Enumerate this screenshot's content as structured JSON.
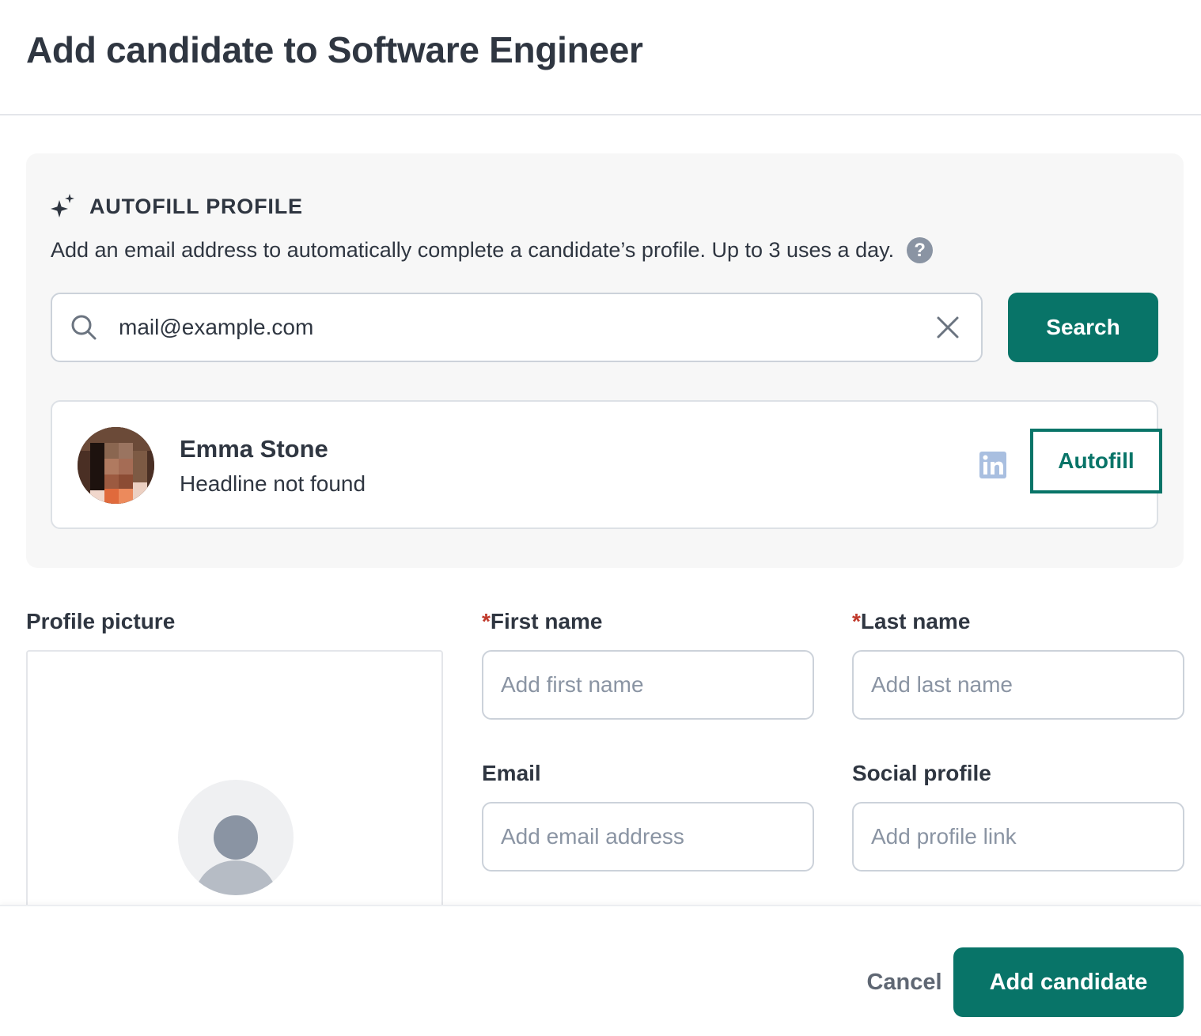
{
  "modal": {
    "title": "Add candidate to Software Engineer"
  },
  "autofill": {
    "title": "AUTOFILL PROFILE",
    "description": "Add an email address to automatically complete a candidate’s profile. Up to 3 uses a day.",
    "help_icon": "question-circle-icon",
    "search_value": "mail@example.com",
    "search_button": "Search",
    "result": {
      "name": "Emma Stone",
      "headline": "Headline not found",
      "social_icon": "linkedin-icon",
      "autofill_button": "Autofill"
    }
  },
  "form": {
    "profile_picture_label": "Profile picture",
    "required_marker": "*",
    "first_name": {
      "label": "First name",
      "placeholder": "Add first name"
    },
    "last_name": {
      "label": "Last name",
      "placeholder": "Add last name"
    },
    "email": {
      "label": "Email",
      "placeholder": "Add email address"
    },
    "social_profile": {
      "label": "Social profile",
      "placeholder": "Add profile link"
    }
  },
  "footer": {
    "cancel": "Cancel",
    "submit": "Add candidate"
  },
  "colors": {
    "primary": "#087468",
    "text": "#2f3641",
    "muted": "#8a94a3",
    "required": "#c0392b",
    "panel_bg": "#f7f7f7"
  }
}
